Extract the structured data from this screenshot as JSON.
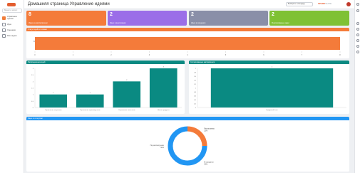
{
  "header": {
    "title": "Домашняя страница Управление идеями",
    "select_value": "Выберите площадку",
    "brand": "SPARK",
    "brand_suffix": "SUITE"
  },
  "sidebar": {
    "search_placeholder": "Введите запрос",
    "items": [
      {
        "label": "Управление идеями",
        "active": true
      },
      {
        "label": "Идеи",
        "active": false
      },
      {
        "label": "Оценщики",
        "active": false
      },
      {
        "label": "Мои задачи",
        "active": false
      }
    ]
  },
  "cards": [
    {
      "value": "8",
      "label": "Идеи на рассмотрении",
      "color": "#f47b3a"
    },
    {
      "value": "2",
      "label": "Идеи в реализации",
      "color": "#9b6ee8"
    },
    {
      "value": "2",
      "label": "Идеи в ожидании",
      "color": "#8a8fa8"
    },
    {
      "value": "2",
      "label": "Реализованные идеи",
      "color": "#7fc134"
    }
  ],
  "panels": {
    "stage_title": "Статус идей по этапам",
    "category_title": "Распределение идей",
    "approved_title": "Согласованные направления",
    "pie_title": "Идеи по статусам"
  },
  "colors": {
    "orange": "#f47b3a",
    "teal": "#0a8a82",
    "blue": "#2196f3"
  },
  "chart_data": [
    {
      "type": "bar",
      "orientation": "horizontal",
      "categories": [
        "ФОКУС"
      ],
      "values": [
        8
      ],
      "xlim": [
        0,
        8
      ],
      "xticks": [
        "0",
        "1",
        "2",
        "3",
        "4",
        "5",
        "6",
        "7",
        "8"
      ],
      "color": "#f47b3a"
    },
    {
      "type": "bar",
      "categories": [
        "Управление затратами",
        "Управление производством",
        "Управление качеством",
        "Новые продукты"
      ],
      "values": [
        1,
        1,
        2,
        3
      ],
      "ylim": [
        0,
        3
      ],
      "yticks": [
        "0",
        "0.5",
        "1",
        "1.5",
        "2",
        "2.5",
        "3"
      ],
      "color": "#0a8a82"
    },
    {
      "type": "bar",
      "categories": [
        "Цифровой блок"
      ],
      "values": [
        2
      ],
      "ylim": [
        0,
        2
      ],
      "yticks": [
        "0",
        "0.2",
        "0.4",
        "0.6",
        "0.8",
        "1",
        "1.2",
        "1.4",
        "1.6",
        "1.8",
        "2"
      ],
      "color": "#0a8a82"
    },
    {
      "type": "pie",
      "style": "donut",
      "slices": [
        {
          "label": "Реализовано",
          "pct": "25%",
          "value": 25,
          "color": "#f47b3a"
        },
        {
          "label": "В ожидании",
          "pct": "25%",
          "value": 25,
          "color": "#2196f3"
        },
        {
          "label": "На рассмотрении",
          "pct": "50%",
          "value": 50,
          "color": "#2196f3"
        }
      ]
    }
  ]
}
